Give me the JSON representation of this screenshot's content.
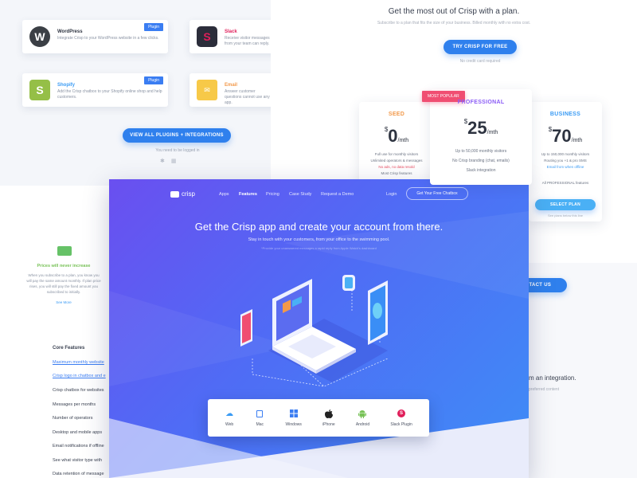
{
  "plugins_page": {
    "cards": [
      {
        "name": "WordPress",
        "desc": "Integrate Crisp to your WordPress website in a few clicks.",
        "badge": "Plugin",
        "logo": "wordpress-icon",
        "color": "#333333"
      },
      {
        "name": "Slack",
        "desc": "Receive visitor messages from your team can reply.",
        "badge": "",
        "logo": "slack-icon",
        "color": "#e01e5a"
      },
      {
        "name": "Shopify",
        "desc": "Add the Crisp chatbox to your Shopify online shop and help customers.",
        "badge": "Plugin",
        "logo": "shopify-icon",
        "color": "#95bf47"
      },
      {
        "name": "Email",
        "desc": "Answer customer questions cannot use any app.",
        "badge": "",
        "logo": "email-icon",
        "color": "#f7c948"
      }
    ],
    "view_all_label": "VIEW ALL PLUGINS + INTEGRATIONS",
    "login_note": "You need to be logged in"
  },
  "pricing_page": {
    "heading": "Get the most out of Crisp with a plan.",
    "subheading": "Subscribe to a plan that fits the size of your business. Billed monthly with no extra cost.",
    "try_label": "TRY CRISP FOR FREE",
    "no_card": "No credit card required",
    "most_popular": "MOST POPULAR",
    "plans": [
      {
        "name": "SEED",
        "currency": "$",
        "amount": "0",
        "period": "/mth",
        "features": [
          "Full use for monthly visitors",
          "Unlimited operators & messages",
          "No ads, no data resold",
          "Most Crisp features"
        ]
      },
      {
        "name": "PROFESSIONAL",
        "currency": "$",
        "amount": "25",
        "period": "/mth",
        "features": [
          "Up to 50,000 monthly visitors",
          "No Crisp branding (chat, emails)",
          "Slack integration"
        ]
      },
      {
        "name": "BUSINESS",
        "currency": "$",
        "amount": "70",
        "period": "/mth",
        "features": [
          "Up to 150,000 monthly visitors",
          "Routing you +1 & pro SMS",
          "Email from when offline",
          "All PROFESSIONAL features"
        ]
      }
    ],
    "select_label": "SELECT PLAN",
    "select_sub": "See plans below this line",
    "contact_label": "NTACT US",
    "integration_text": "m an integration.",
    "integration_sub": "preferred content"
  },
  "features_page": {
    "pricing_title": "Prices will never increase",
    "pricing_desc": "When you subscribe to a plan, you know you will pay the same amount monthly. If plan price rises, you will still pay the fixed amount you subscribed to initially.",
    "see_more": "See More",
    "core_title": "Core Features",
    "items": [
      "Maximum monthly website",
      "Crisp logo in chatbox and e",
      "Crisp chatbox for websites",
      "Messages per months",
      "Number of operators",
      "Desktop and mobile apps",
      "Email notifications if offline",
      "See what visitor type with",
      "Data retention of message"
    ]
  },
  "hero": {
    "logo_text": "crisp",
    "nav": [
      "Apps",
      "Features",
      "Pricing",
      "Case Study",
      "Request a Demo"
    ],
    "active_nav": "Features",
    "login": "Login",
    "cta": "Get Your Free Chatbox",
    "title": "Get the Crisp app and create your account from there.",
    "subtitle": "Stay in touch with your customers, from your office to the swimming pool.",
    "note": "*Provide your unanswered messages a rapid reply from Apple Watch’s dashboard",
    "platforms": [
      {
        "label": "Web",
        "icon": "cloud-icon",
        "color": "#3a9bf4"
      },
      {
        "label": "Mac",
        "icon": "mac-icon",
        "color": "#3a7df2"
      },
      {
        "label": "Windows",
        "icon": "windows-icon",
        "color": "#3a7df2"
      },
      {
        "label": "iPhone",
        "icon": "apple-icon",
        "color": "#222222"
      },
      {
        "label": "Android",
        "icon": "android-icon",
        "color": "#78c257"
      },
      {
        "label": "Slack Plugin",
        "icon": "slack-plugin-icon",
        "color": "#e01e5a"
      }
    ]
  }
}
